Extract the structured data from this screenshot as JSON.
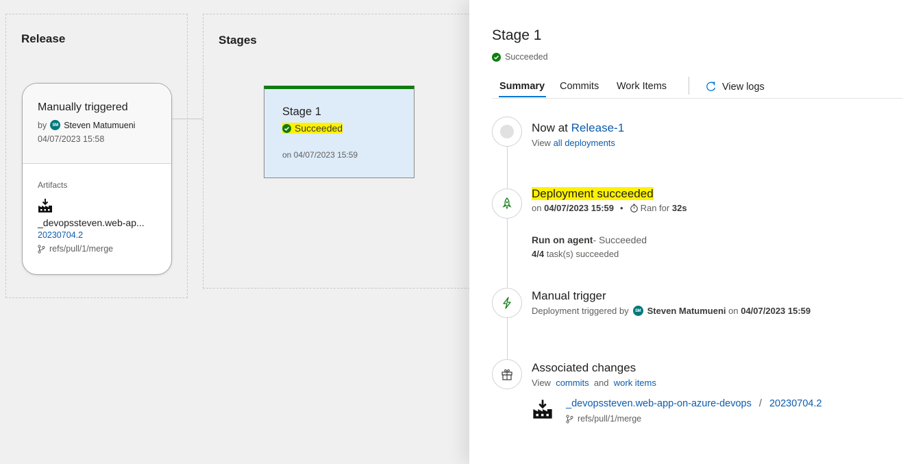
{
  "release": {
    "section_title": "Release",
    "trigger_title": "Manually triggered",
    "by_label": "by",
    "user_initials": "SM",
    "user_name": "Steven Matumueni",
    "date": "04/07/2023 15:58",
    "artifacts_label": "Artifacts",
    "artifact_name": "_devopssteven.web-ap...",
    "artifact_version": "20230704.2",
    "branch": "refs/pull/1/merge"
  },
  "stages": {
    "section_title": "Stages",
    "stage_name": "Stage 1",
    "stage_status": "Succeeded",
    "stage_date": "on 04/07/2023 15:59"
  },
  "detail": {
    "title": "Stage 1",
    "status": "Succeeded",
    "tabs": [
      "Summary",
      "Commits",
      "Work Items"
    ],
    "view_logs": "View logs",
    "now_at_prefix": "Now at",
    "release_link": "Release-1",
    "view_prefix": "View",
    "all_deployments": "all deployments",
    "deploy_title": "Deployment succeeded",
    "on_label": "on",
    "deploy_date": "04/07/2023 15:59",
    "ran_for_label": "Ran for",
    "ran_for_value": "32s",
    "agent_label": "Run on agent",
    "agent_status": " - Succeeded",
    "tasks_count": "4/4",
    "tasks_text": "task(s) succeeded",
    "manual_trigger": "Manual trigger",
    "triggered_by": "Deployment triggered by",
    "trigger_user": "Steven Matumueni",
    "trigger_date": "04/07/2023 15:59",
    "assoc_title": "Associated changes",
    "and_label": "and",
    "commits_link": "commits",
    "work_items_link": "work items",
    "artifact_full": "_devopssteven.web-app-on-azure-devops",
    "artifact_sep": "/",
    "artifact_version": "20230704.2",
    "branch": "refs/pull/1/merge"
  },
  "colors": {
    "accent": "#0078d4",
    "success": "#107c10",
    "highlight": "#fff200",
    "stage_bg": "#deecf9",
    "avatar": "#03787c"
  }
}
